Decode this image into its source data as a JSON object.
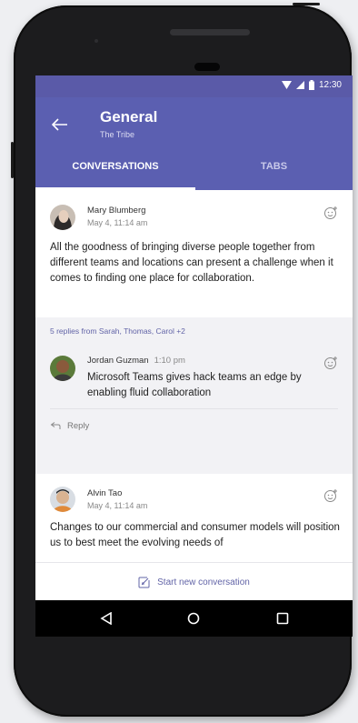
{
  "status_bar": {
    "time": "12:30"
  },
  "app_bar": {
    "title": "General",
    "subtitle": "The Tribe",
    "tabs": [
      {
        "label": "CONVERSATIONS",
        "selected": true
      },
      {
        "label": "TABS",
        "selected": false
      }
    ]
  },
  "posts": [
    {
      "author": "Mary Blumberg",
      "timestamp": "May 4, 11:14 am",
      "body": "All the goodness of bringing diverse people together from different teams and locations can present a challenge when it comes to finding one place for collaboration.",
      "replies_summary": "5 replies from Sarah, Thomas, Carol +2",
      "reply": {
        "author": "Jordan Guzman",
        "time": "1:10 pm",
        "body": "Microsoft Teams gives hack teams an edge by enabling fluid collaboration"
      },
      "reply_label": "Reply"
    },
    {
      "author": "Alvin Tao",
      "timestamp": "May 4, 11:14 am",
      "body": "Changes to our commercial and consumer models will position us to best meet the evolving needs of"
    }
  ],
  "compose": {
    "label": "Start new conversation"
  },
  "colors": {
    "brand": "#5b5fb1",
    "link": "#6264a7"
  },
  "icons": [
    "back-arrow-icon",
    "wifi-icon",
    "signal-icon",
    "battery-icon",
    "add-reaction-icon",
    "reply-arrow-icon",
    "compose-icon",
    "nav-back-icon",
    "nav-home-icon",
    "nav-recents-icon"
  ]
}
